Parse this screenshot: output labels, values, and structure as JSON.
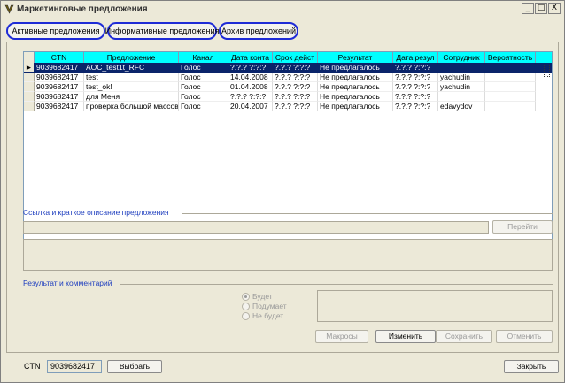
{
  "window": {
    "title": "Маркетинговые предложения",
    "minimize": "_",
    "maximize": "□",
    "close": "X"
  },
  "tabs": [
    {
      "label": "Активные предложения"
    },
    {
      "label": "Информативные предложения"
    },
    {
      "label": "Архив предложений"
    }
  ],
  "grid": {
    "columns": [
      "CTN",
      "Предложение",
      "Канал",
      "Дата конта",
      "Срок дейст",
      "Результат",
      "Дата резул",
      "Сотрудник",
      "Вероятность"
    ],
    "rows": [
      {
        "cells": [
          "9039682417",
          "AOC_test1t_RFC",
          "Голос",
          "?.?.? ?:?:?",
          "?.?.? ?:?:?",
          "Не предлагалось",
          "?.?.? ?:?:?",
          "",
          ""
        ],
        "selected": true
      },
      {
        "cells": [
          "9039682417",
          "test",
          "Голос",
          "14.04.2008",
          "?.?.? ?:?:?",
          "Не предлагалось",
          "?.?.? ?:?:?",
          "yachudin",
          ""
        ]
      },
      {
        "cells": [
          "9039682417",
          "test_ok!",
          "Голос",
          "01.04.2008",
          "?.?.? ?:?:?",
          "Не предлагалось",
          "?.?.? ?:?:?",
          "yachudin",
          ""
        ]
      },
      {
        "cells": [
          "9039682417",
          "для Меня",
          "Голос",
          "?.?.? ?:?:?",
          "?.?.? ?:?:?",
          "Не предлагалось",
          "?.?.? ?:?:?",
          "",
          ""
        ]
      },
      {
        "cells": [
          "9039682417",
          "проверка большой массов",
          "Голос",
          "20.04.2007",
          "?.?.? ?:?:?",
          "Не предлагалось",
          "?.?.? ?:?:?",
          "edavydov",
          ""
        ]
      }
    ],
    "selected_indicator": "►"
  },
  "link_section": {
    "label": "Ссылка и краткое описание предложения",
    "goto_button": "Перейти"
  },
  "result_section": {
    "label": "Результат и комментарий",
    "radios": [
      {
        "label": "Будет",
        "checked": true
      },
      {
        "label": "Подумает",
        "checked": false
      },
      {
        "label": "Не будет",
        "checked": false
      }
    ],
    "buttons": {
      "macros": "Макросы",
      "edit": "Изменить",
      "save": "Сохранить",
      "cancel": "Отменить"
    }
  },
  "footer": {
    "ctn_label": "CTN",
    "ctn_value": "9039682417",
    "select_button": "Выбрать",
    "close_button": "Закрыть"
  },
  "colors": {
    "header": "#00ffff",
    "selection": "#0a246a",
    "tab_outline": "#1e2bd6",
    "section_label": "#1f3fbf"
  }
}
